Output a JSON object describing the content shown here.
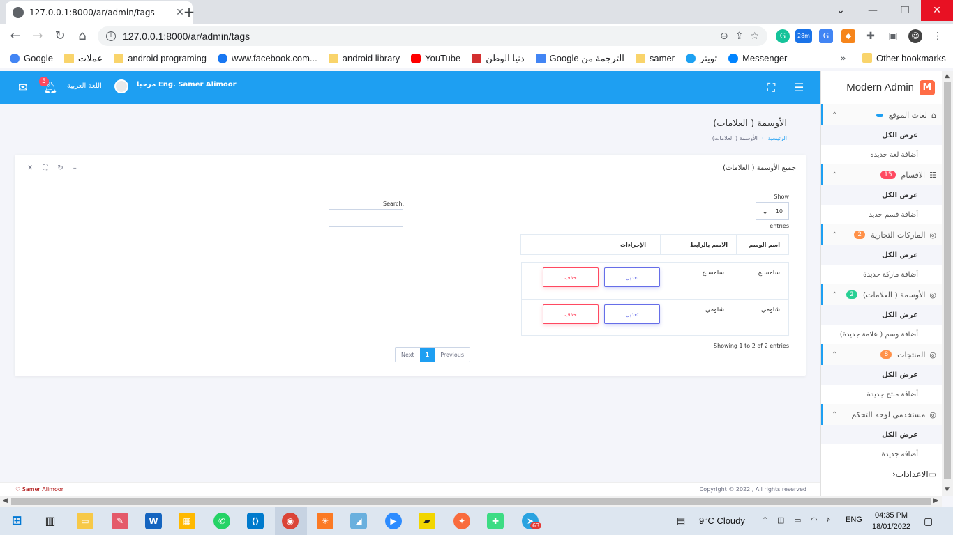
{
  "browser": {
    "tab_title": "127.0.0.1:8000/ar/admin/tags",
    "url": "127.0.0.1:8000/ar/admin/tags",
    "bookmarks": [
      "Google",
      "عملات",
      "android programing",
      "www.facebook.com...",
      "android library",
      "YouTube",
      "دنيا الوطن",
      "Google الترجمة من",
      "samer",
      "تويتر",
      "Messenger"
    ],
    "other_bookmarks": "Other bookmarks",
    "ext_badge": "28m"
  },
  "topnav": {
    "notif_count": "5",
    "lang": "اللغة العربية",
    "user": "مرحبا  Eng. Samer Alimoor"
  },
  "sidebar": {
    "brand": "Modern Admin",
    "brand_logo": "M",
    "groups": [
      {
        "title": "لغات الموقع",
        "badge": "",
        "badge_color": "#1e9ff2",
        "sub": [
          "عرض الكل",
          "أضافة لغة جديدة"
        ]
      },
      {
        "title": "الاقسام",
        "badge": "15",
        "badge_color": "#ff4961",
        "sub": [
          "عرض الكل",
          "أضافة قسم جديد"
        ]
      },
      {
        "title": "الماركات التجارية",
        "badge": "2",
        "badge_color": "#ff9149",
        "sub": [
          "عرض الكل",
          "أضافة ماركة جديدة"
        ]
      },
      {
        "title": "الأوسمة ( العلامات)",
        "badge": "2",
        "badge_color": "#28d094",
        "sub": [
          "عرض الكل",
          "أضافة وسم ( علامة جديدة)"
        ]
      },
      {
        "title": "المنتجات",
        "badge": "8",
        "badge_color": "#ff9149",
        "sub": [
          "عرض الكل",
          "أضافة منتج جديدة"
        ]
      },
      {
        "title": "مستخدمي لوحه التحكم",
        "badge": "",
        "badge_color": "",
        "sub": [
          "عرض الكل",
          "أضافة جديدة"
        ]
      }
    ],
    "settings": "الاعدادات"
  },
  "page": {
    "title": "الأوسمة ( العلامات)",
    "breadcrumb_home": "الرئيسية",
    "breadcrumb_current": "الأوسمة ( العلامات)"
  },
  "card": {
    "title": "جميع الأوسمة ( العلامات)",
    "show_label": "Show",
    "show_value": "10",
    "entries_label": "entries",
    "search_label": "Search:",
    "columns": [
      "اسم الوسم",
      "الاسم بالرابط",
      "الإجراءات"
    ],
    "rows": [
      {
        "name": "سامسنج",
        "slug": "سامسنج",
        "edit": "تعديل",
        "delete": "حذف"
      },
      {
        "name": "شاومي",
        "slug": "شاومي",
        "edit": "تعديل",
        "delete": "حذف"
      }
    ],
    "info": "Showing 1 to 2 of 2 entries",
    "pager": {
      "previous": "Previous",
      "current": "1",
      "next": "Next"
    }
  },
  "footer": {
    "left": "Samer  Alimoor",
    "right": "Copyright © 2022 , All rights reserved"
  },
  "taskbar": {
    "weather": "9°C  Cloudy",
    "lang": "ENG",
    "time": "04:35 PM",
    "date": "18/01/2022",
    "telegram_badge": "63"
  },
  "colors": {
    "primary": "#1e9ff2",
    "danger": "#ff4961",
    "edit": "#666ee8"
  }
}
